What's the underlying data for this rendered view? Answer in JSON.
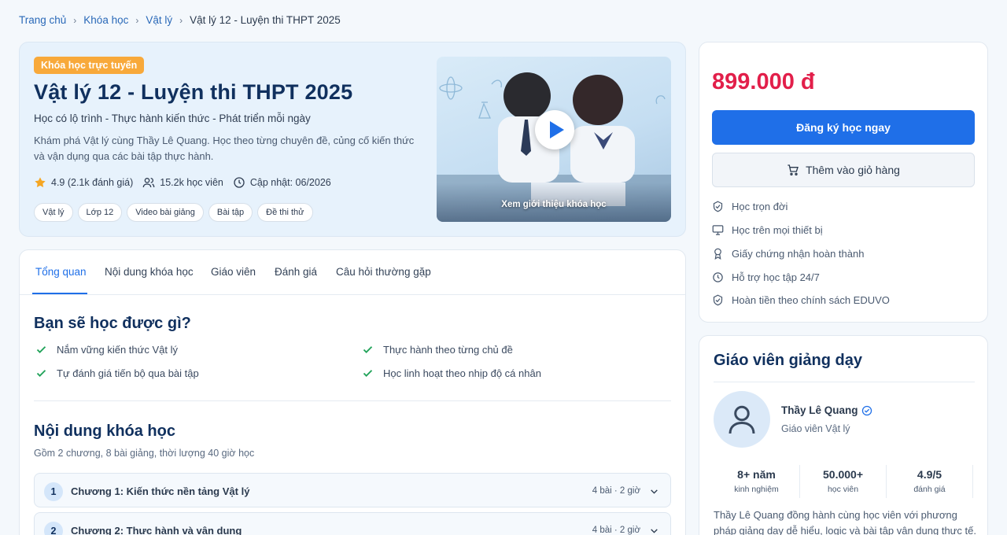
{
  "breadcrumb": {
    "home": "Trang chủ",
    "courses": "Khóa học",
    "subject": "Vật lý",
    "current": "Vật lý 12 - Luyện thi THPT 2025"
  },
  "hero": {
    "badge": "Khóa học trực tuyến",
    "title": "Vật lý 12 - Luyện thi THPT 2025",
    "subtitle": "Học có lộ trình - Thực hành kiến thức - Phát triển mỗi ngày",
    "description": "Khám phá Vật lý cùng Thầy Lê Quang. Học theo từng chuyên đề, củng cố kiến thức và vận dụng qua các bài tập thực hành.",
    "rating": "4.9 (2.1k đánh giá)",
    "students": "15.2k học viên",
    "updated": "Cập nhật: 06/2026",
    "tags": [
      "Vật lý",
      "Lớp 12",
      "Video bài giảng",
      "Bài tập",
      "Đề thi thử"
    ],
    "video_caption": "Xem giới thiệu khóa học"
  },
  "tabs": [
    "Tổng quan",
    "Nội dung khóa học",
    "Giáo viên",
    "Đánh giá",
    "Câu hỏi thường gặp"
  ],
  "learn": {
    "title": "Bạn sẽ học được gì?",
    "items": [
      "Nắm vững kiến thức Vật lý",
      "Thực hành theo từng chủ đề",
      "Tự đánh giá tiến bộ qua bài tập",
      "Học linh hoạt theo nhịp độ cá nhân"
    ]
  },
  "curriculum": {
    "title": "Nội dung khóa học",
    "summary": "Gồm 2 chương, 8 bài giảng, thời lượng 40 giờ học",
    "chapters": [
      {
        "num": "1",
        "title": "Chương 1: Kiến thức nền tảng Vật lý",
        "meta": "4 bài · 2 giờ"
      },
      {
        "num": "2",
        "title": "Chương 2: Thực hành và vận dụng",
        "meta": "4 bài · 2 giờ"
      }
    ]
  },
  "purchase": {
    "price": "899.000 đ",
    "enroll_label": "Đăng ký học ngay",
    "cart_label": "Thêm vào giỏ hàng",
    "features": [
      "Học trọn đời",
      "Học trên mọi thiết bị",
      "Giấy chứng nhận hoàn thành",
      "Hỗ trợ học tập 24/7",
      "Hoàn tiền theo chính sách EDUVO"
    ]
  },
  "teacher": {
    "heading": "Giáo viên giảng dạy",
    "name": "Thầy Lê Quang",
    "role": "Giáo viên Vật lý",
    "stats": [
      {
        "value": "8+ năm",
        "label": "kinh nghiệm"
      },
      {
        "value": "50.000+",
        "label": "học viên"
      },
      {
        "value": "4.9/5",
        "label": "đánh giá"
      }
    ],
    "bio": "Thầy Lê Quang đồng hành cùng học viên với phương pháp giảng dạy dễ hiểu, logic và bài tập vận dụng thực tế."
  },
  "colors": {
    "primary": "#1f6fe8",
    "price": "#e21f4a",
    "badge": "#f8a93a",
    "heading": "#10305e",
    "check": "#22a35a",
    "star": "#f5a623"
  }
}
